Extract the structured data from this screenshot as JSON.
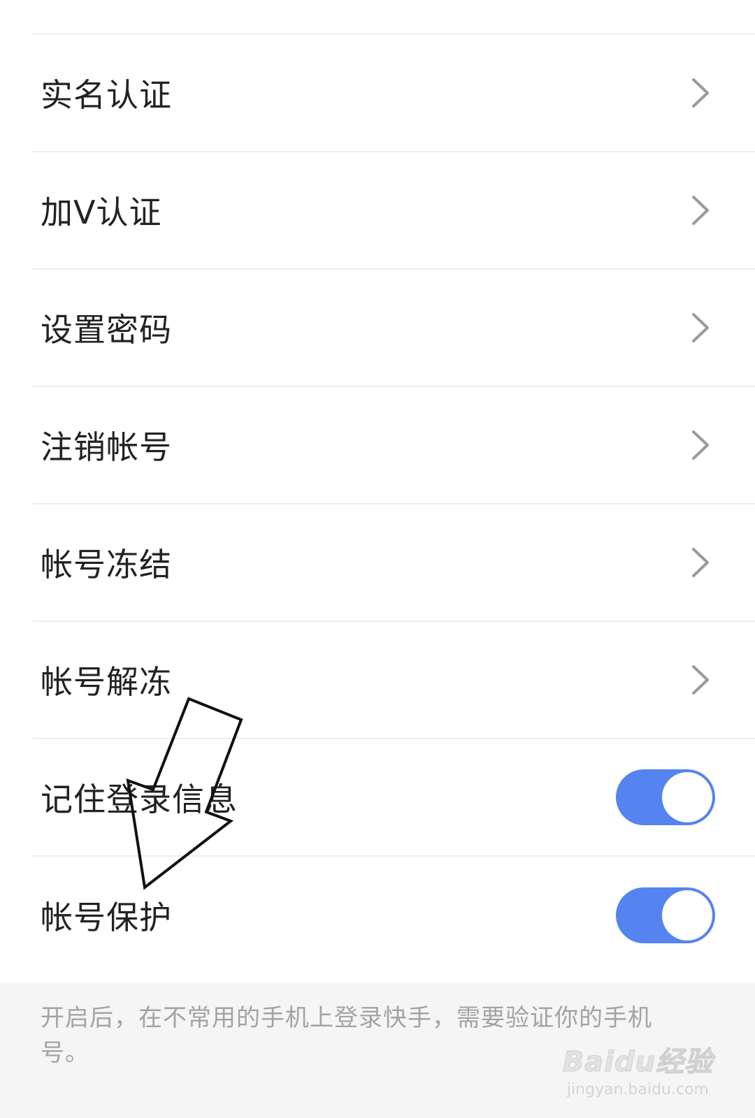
{
  "settings": {
    "items": [
      {
        "label": "实名认证",
        "type": "link",
        "icon": "chevron-right-icon"
      },
      {
        "label": "加V认证",
        "type": "link",
        "icon": "chevron-right-icon"
      },
      {
        "label": "设置密码",
        "type": "link",
        "icon": "chevron-right-icon"
      },
      {
        "label": "注销帐号",
        "type": "link",
        "icon": "chevron-right-icon"
      },
      {
        "label": "帐号冻结",
        "type": "link",
        "icon": "chevron-right-icon"
      },
      {
        "label": "帐号解冻",
        "type": "link",
        "icon": "chevron-right-icon"
      },
      {
        "label": "记住登录信息",
        "type": "toggle",
        "on": true
      },
      {
        "label": "帐号保护",
        "type": "toggle",
        "on": true
      }
    ]
  },
  "footer": {
    "note": "开启后，在不常用的手机上登录快手，需要验证你的手机号。"
  },
  "watermark": {
    "logo": "Baidu经验",
    "url": "jingyan.baidu.com"
  },
  "colors": {
    "toggle_on": "#5583f0",
    "text": "#222222",
    "note": "#a3a3a3",
    "divider": "#ececec",
    "footer_bg": "#f5f5f5"
  }
}
